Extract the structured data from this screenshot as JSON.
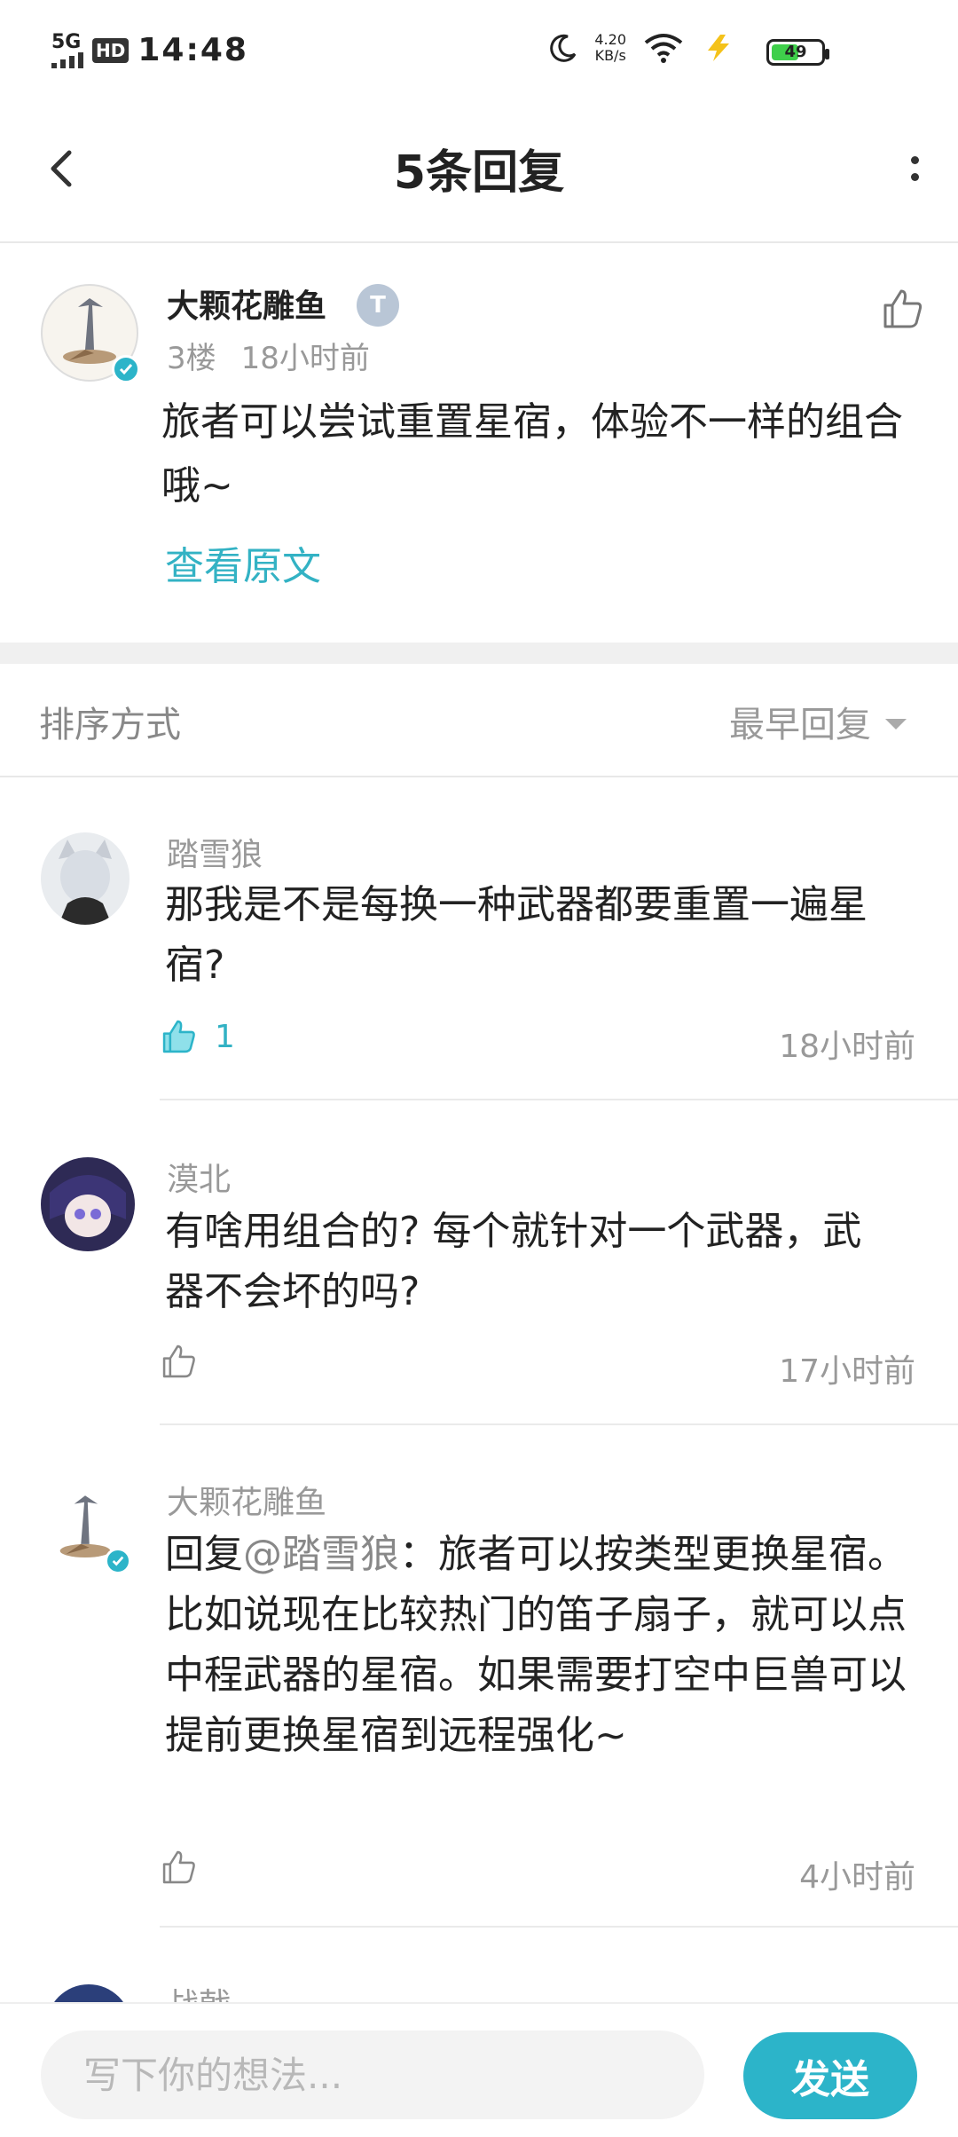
{
  "status_bar": {
    "network": "5G",
    "hd": "HD",
    "time": "14:48",
    "speed_value": "4.20",
    "speed_unit": "KB/s",
    "battery": "49"
  },
  "header": {
    "title": "5条回复"
  },
  "post": {
    "author": "大颗花雕鱼",
    "level_badge": "T",
    "floor": "3楼",
    "time": "18小时前",
    "content": "旅者可以尝试重置星宿，体验不一样的组合哦~",
    "view_original": "查看原文"
  },
  "sort": {
    "label": "排序方式",
    "value": "最早回复"
  },
  "replies": [
    {
      "name": "踏雪狼",
      "text": "那我是不是每换一种武器都要重置一遍星宿?",
      "likes": "1",
      "time": "18小时前"
    },
    {
      "name": "漠北",
      "text": "有啥用组合的? 每个就针对一个武器，武器不会坏的吗?",
      "likes": "",
      "time": "17小时前"
    },
    {
      "name": "大颗花雕鱼",
      "reply_prefix": "回复",
      "mention": "@踏雪狼",
      "text": "：旅者可以按类型更换星宿。比如说现在比较热门的笛子扇子，就可以点中程武器的星宿。如果需要打空中巨兽可以提前更换星宿到远程强化~",
      "likes": "",
      "time": "4小时前"
    },
    {
      "name": "战戟"
    }
  ],
  "input": {
    "placeholder": "写下你的想法...",
    "send_label": "发送"
  },
  "colors": {
    "accent": "#2cb4c9",
    "link": "#33b2c4"
  }
}
